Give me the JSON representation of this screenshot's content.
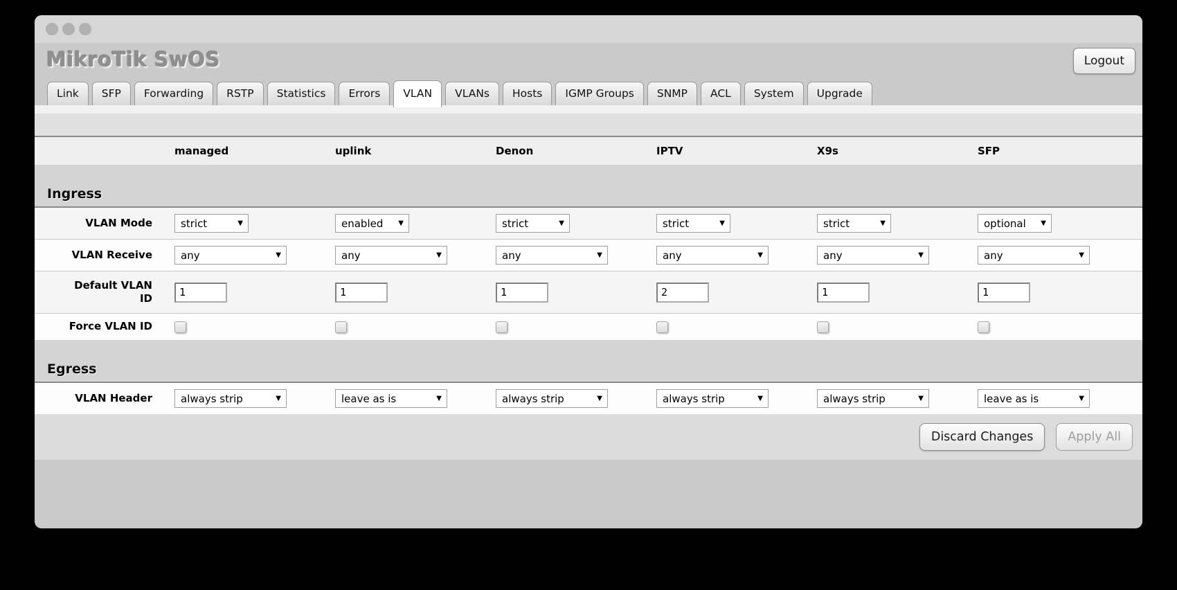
{
  "window": {
    "title": "MikroTik SwOS",
    "logout_label": "Logout"
  },
  "tabs": [
    {
      "label": "Link",
      "active": false
    },
    {
      "label": "SFP",
      "active": false
    },
    {
      "label": "Forwarding",
      "active": false
    },
    {
      "label": "RSTP",
      "active": false
    },
    {
      "label": "Statistics",
      "active": false
    },
    {
      "label": "Errors",
      "active": false
    },
    {
      "label": "VLAN",
      "active": true
    },
    {
      "label": "VLANs",
      "active": false
    },
    {
      "label": "Hosts",
      "active": false
    },
    {
      "label": "IGMP Groups",
      "active": false
    },
    {
      "label": "SNMP",
      "active": false
    },
    {
      "label": "ACL",
      "active": false
    },
    {
      "label": "System",
      "active": false
    },
    {
      "label": "Upgrade",
      "active": false
    }
  ],
  "table": {
    "columns": [
      "managed",
      "uplink",
      "Denon",
      "IPTV",
      "X9s",
      "SFP"
    ],
    "sections": [
      {
        "title": "Ingress",
        "rows": [
          {
            "label": "VLAN Mode",
            "type": "select",
            "size": "small",
            "shade": true,
            "values": [
              "strict",
              "enabled",
              "strict",
              "strict",
              "strict",
              "optional"
            ]
          },
          {
            "label": "VLAN Receive",
            "type": "select",
            "size": "large",
            "shade": false,
            "values": [
              "any",
              "any",
              "any",
              "any",
              "any",
              "any"
            ]
          },
          {
            "label": "Default VLAN ID",
            "type": "input",
            "shade": true,
            "values": [
              "1",
              "1",
              "1",
              "2",
              "1",
              "1"
            ]
          },
          {
            "label": "Force VLAN ID",
            "type": "checkbox",
            "shade": false,
            "values": [
              false,
              false,
              false,
              false,
              false,
              false
            ]
          }
        ]
      },
      {
        "title": "Egress",
        "rows": [
          {
            "label": "VLAN Header",
            "type": "select",
            "size": "large",
            "shade": false,
            "values": [
              "always strip",
              "leave as is",
              "always strip",
              "always strip",
              "always strip",
              "leave as is"
            ]
          }
        ]
      }
    ]
  },
  "buttons": {
    "discard": {
      "label": "Discard Changes",
      "disabled": false
    },
    "apply": {
      "label": "Apply All",
      "disabled": true
    }
  },
  "icons": {
    "dropdown_arrow": "▼",
    "traffic_light": "circle"
  },
  "colors": {
    "window_bg": "#cacaca",
    "titlebar_bg": "#d7d7d7",
    "section_bg": "#d4d4d4",
    "row_bg": "#fdfdfd",
    "row_shade_bg": "#f5f5f5",
    "divider": "#8a8a8a",
    "active_tab_bg": "#ffffff",
    "button_area_bg": "#dcdcdc"
  }
}
